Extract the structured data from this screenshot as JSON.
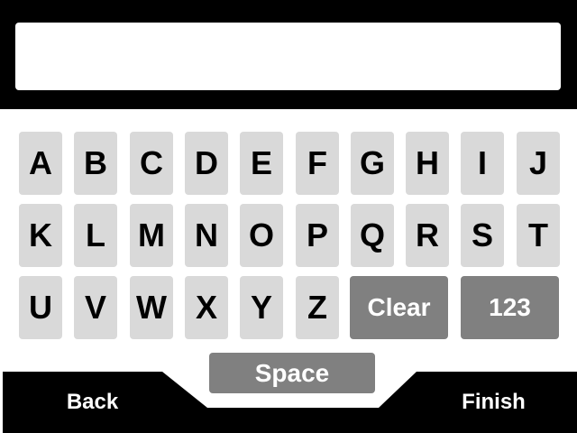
{
  "input": {
    "value": "",
    "placeholder": ""
  },
  "keyboard": {
    "row1": [
      "A",
      "B",
      "C",
      "D",
      "E",
      "F",
      "G",
      "H",
      "I",
      "J"
    ],
    "row2": [
      "K",
      "L",
      "M",
      "N",
      "O",
      "P",
      "Q",
      "R",
      "S",
      "T"
    ],
    "row3": [
      "U",
      "V",
      "W",
      "X",
      "Y",
      "Z"
    ],
    "clear_label": "Clear",
    "numbers_label": "123",
    "space_label": "Space"
  },
  "nav": {
    "back_label": "Back",
    "finish_label": "Finish"
  },
  "colors": {
    "bar": "#000000",
    "key": "#d9d9d9",
    "key_dark": "#808080",
    "key_text": "#000000",
    "key_dark_text": "#ffffff"
  }
}
